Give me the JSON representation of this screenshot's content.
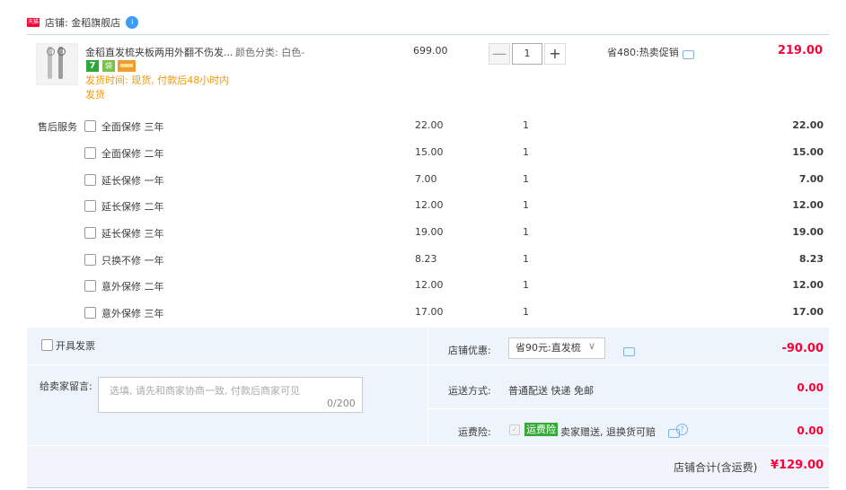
{
  "shop": {
    "tmall_badge": "天猫",
    "label": "店铺: 金稻旗舰店",
    "ww_icon": "i"
  },
  "item": {
    "title": "金稻直发梳夹板两用外翻不伤发...",
    "sku": "颜色分类: 白色-",
    "badge7": "7",
    "badge_bag": "袋",
    "ship_time": "发货时间: 现货, 付款后48小时内发货",
    "unit_price": "699.00",
    "qty": "1",
    "qty_minus": "—",
    "qty_plus": "+",
    "promo": "省480:热卖促销",
    "total": "219.00"
  },
  "services": {
    "label": "售后服务",
    "rows": [
      {
        "name": "全面保修 三年",
        "price": "22.00",
        "qty": "1",
        "total": "22.00"
      },
      {
        "name": "全面保修 二年",
        "price": "15.00",
        "qty": "1",
        "total": "15.00"
      },
      {
        "name": "延长保修 一年",
        "price": "7.00",
        "qty": "1",
        "total": "7.00"
      },
      {
        "name": "延长保修 二年",
        "price": "12.00",
        "qty": "1",
        "total": "12.00"
      },
      {
        "name": "延长保修 三年",
        "price": "19.00",
        "qty": "1",
        "total": "19.00"
      },
      {
        "name": "只换不修 一年",
        "price": "8.23",
        "qty": "1",
        "total": "8.23"
      },
      {
        "name": "意外保修 二年",
        "price": "12.00",
        "qty": "1",
        "total": "12.00"
      },
      {
        "name": "意外保修 三年",
        "price": "17.00",
        "qty": "1",
        "total": "17.00"
      }
    ]
  },
  "invoice": {
    "label": "开具发票"
  },
  "message": {
    "label": "给卖家留言:",
    "placeholder": "选填, 请先和商家协商一致, 付款后商家可见",
    "count": "0/200"
  },
  "discount": {
    "label": "店铺优惠:",
    "selected": "省90元:直发梳",
    "arrow": "∨",
    "amount": "-90.00"
  },
  "shipping": {
    "label": "运送方式:",
    "value": "普通配送 快递 免邮",
    "amount": "0.00"
  },
  "insurance": {
    "label": "运费险:",
    "check": "✓",
    "badge": "运费险",
    "desc": "卖家赠送, 退换货可赔",
    "help": "?",
    "amount": "0.00"
  },
  "summary": {
    "label": "店铺合计(含运费)",
    "amount": "¥129.00"
  },
  "colors": {
    "accent": "#ff0036",
    "link": "#3b9cf2",
    "panel": "#eef4fb"
  }
}
